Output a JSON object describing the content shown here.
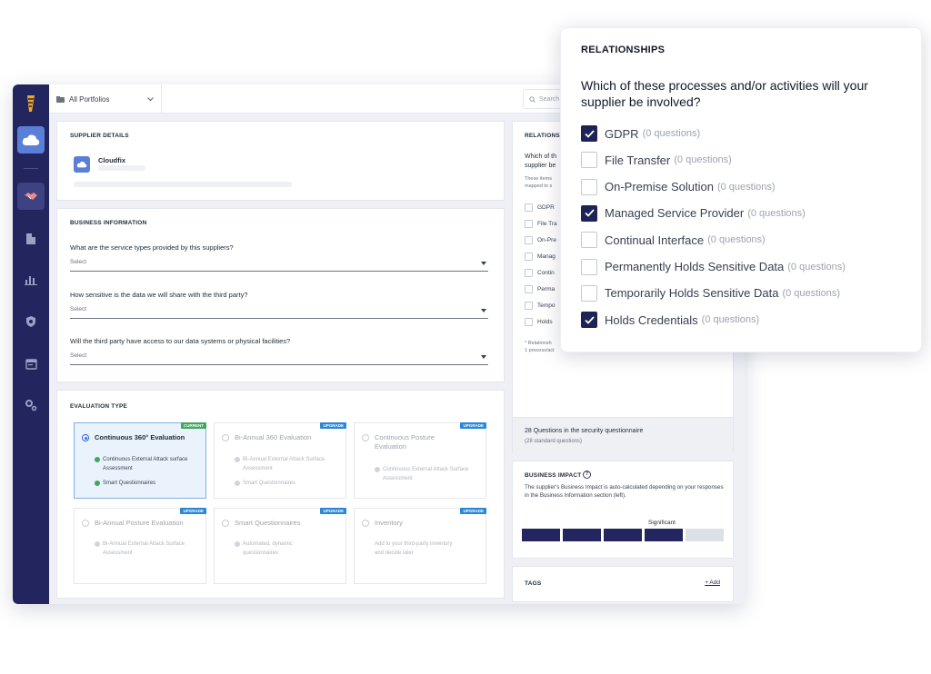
{
  "topbar": {
    "portfolio": "All Portfolios",
    "search_placeholder": "Search"
  },
  "supplier_details": {
    "title": "SUPPLIER DETAILS",
    "name": "Cloudfix"
  },
  "business_info": {
    "title": "BUSINESS INFORMATION",
    "questions": [
      {
        "q": "What are the service types provided by this suppliers?",
        "select": "Select"
      },
      {
        "q": "How sensitive is the data we will share with the third party?",
        "select": "Select"
      },
      {
        "q": "Will the third party have access to our data systems or physical facilities?",
        "select": "Select"
      }
    ]
  },
  "evaluation": {
    "title": "EVALUATION TYPE",
    "options": [
      {
        "title": "Continuous 360° Evaluation",
        "badge": "CURRENT",
        "features": [
          "Continuous External Attack surface Assessment",
          "Smart Questionnaires"
        ]
      },
      {
        "title": "Bi-Annual 360 Evaluation",
        "badge": "UPGRADE",
        "features": [
          "Bi-Annual External Attack Surface Assessment",
          "Smart Questionnaires"
        ]
      },
      {
        "title": "Continuous Posture Evaluation",
        "badge": "UPGRADE",
        "features": [
          "Continuous External Attack Surface Assessment"
        ]
      },
      {
        "title": "Bi-Annual Posture Evaluation",
        "badge": "UPGRADE",
        "features": [
          "Bi-Annual External Attack Surface Assessment"
        ]
      },
      {
        "title": "Smart Questionnaires",
        "badge": "UPGRADE",
        "features": [
          "Automated, dynamic questionnaires"
        ]
      },
      {
        "title": "Inventory",
        "badge": "UPGRADE",
        "description": "Add to your third-party inventory and decide later"
      }
    ]
  },
  "relationships_bg": {
    "title": "RELATIONSHI",
    "question": "Which of th\nsupplier be",
    "note": "These items\nmapped to s",
    "items": [
      "GDPR",
      "File Tra",
      "On-Pre",
      "Manag",
      "Contin",
      "Perma",
      "Tempo",
      "Holds"
    ],
    "footnote": "* Relationsh\n1 process/act",
    "questions_total": "28 Questions in the security questionnaire",
    "questions_sub": "(28 standard questions)"
  },
  "business_impact": {
    "title": "BUSINESS IMPACT",
    "description": "The supplier's Business Impact is auto-calculated depending on your responses in the Business Information section (left).",
    "level_label": "Significant",
    "level": 4,
    "segments": 5,
    "colors": {
      "filled": "#23265e",
      "empty": "#dde0e6"
    }
  },
  "tags": {
    "title": "TAGS",
    "add": "+ Add"
  },
  "popup": {
    "title": "RELATIONSHIPS",
    "question": "Which of these processes and/or activities will your supplier be involved?",
    "items": [
      {
        "label": "GDPR",
        "count": "(0 questions)",
        "checked": true
      },
      {
        "label": "File Transfer",
        "count": "(0  questions)",
        "checked": false
      },
      {
        "label": "On-Premise Solution",
        "count": "(0 questions)",
        "checked": false
      },
      {
        "label": "Managed Service Provider",
        "count": "(0 questions)",
        "checked": true
      },
      {
        "label": "Continual Interface",
        "count": "(0 questions)",
        "checked": false
      },
      {
        "label": "Permanently Holds Sensitive Data",
        "count": "(0 questions)",
        "checked": false
      },
      {
        "label": "Temporarily Holds Sensitive Data",
        "count": "(0 questions)",
        "checked": false
      },
      {
        "label": "Holds Credentials",
        "count": "(0 questions)",
        "checked": true
      }
    ]
  }
}
